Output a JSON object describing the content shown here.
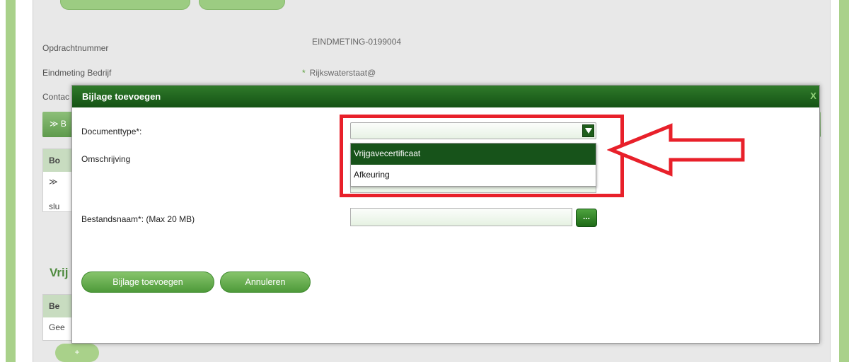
{
  "background": {
    "fields": [
      {
        "label": "Opdrachtnummer",
        "value": "EINDMETING-0199004"
      },
      {
        "label": "Eindmeting Bedrijf",
        "value": "Rijkswaterstaat@",
        "required": true
      },
      {
        "label": "Contac"
      }
    ],
    "section_bar_text": "≫ B",
    "table1": {
      "header": "Bo",
      "row1": "≫",
      "row2": "slu"
    },
    "section_heading": "Vrij",
    "table2": {
      "header": "Be",
      "row1": "Gee"
    },
    "add_button": "+"
  },
  "dialog": {
    "title": "Bijlage toevoegen",
    "close_label": "X",
    "documenttype_label": "Documenttype*:",
    "omschrijving_label": "Omschrijving",
    "bestandsnaam_label": "Bestandsnaam*: (Max 20 MB)",
    "dropdown_options": [
      "Vrijgavecertificaat",
      "Afkeuring"
    ],
    "browse_label": "...",
    "add_button": "Bijlage toevoegen",
    "cancel_button": "Annuleren"
  },
  "colors": {
    "header_green": "#145214",
    "accent_green": "#4e9a3a",
    "annotation_red": "#e8202a"
  }
}
